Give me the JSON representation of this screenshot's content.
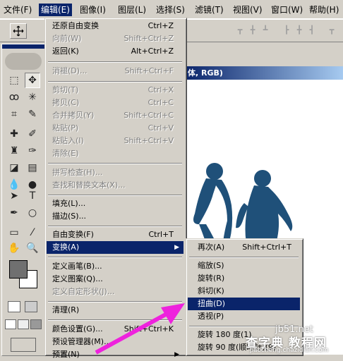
{
  "menubar": {
    "items": [
      "文件(F)",
      "编辑(E)",
      "图像(I)",
      "图层(L)",
      "选择(S)",
      "滤镜(T)",
      "视图(V)",
      "窗口(W)",
      "帮助(H)"
    ]
  },
  "document": {
    "title_visible": "体, RGB)"
  },
  "edit_menu": {
    "items": [
      {
        "label": "还原自由变换",
        "shortcut": "Ctrl+Z"
      },
      {
        "label": "向前(W)",
        "shortcut": "Shift+Ctrl+Z"
      },
      {
        "label": "返回(K)",
        "shortcut": "Alt+Ctrl+Z"
      },
      {
        "label": "消褪(D)...",
        "shortcut": "Shift+Ctrl+F"
      },
      {
        "label": "剪切(T)",
        "shortcut": "Ctrl+X"
      },
      {
        "label": "拷贝(C)",
        "shortcut": "Ctrl+C"
      },
      {
        "label": "合并拷贝(Y)",
        "shortcut": "Shift+Ctrl+C"
      },
      {
        "label": "粘贴(P)",
        "shortcut": "Ctrl+V"
      },
      {
        "label": "粘贴入(I)",
        "shortcut": "Shift+Ctrl+V"
      },
      {
        "label": "清除(E)",
        "shortcut": ""
      },
      {
        "label": "拼写检查(H)...",
        "shortcut": ""
      },
      {
        "label": "查找和替换文本(X)...",
        "shortcut": ""
      },
      {
        "label": "填充(L)...",
        "shortcut": ""
      },
      {
        "label": "描边(S)...",
        "shortcut": ""
      },
      {
        "label": "自由变换(F)",
        "shortcut": "Ctrl+T"
      },
      {
        "label": "变换(A)",
        "shortcut": ""
      },
      {
        "label": "定义画笔(B)...",
        "shortcut": ""
      },
      {
        "label": "定义图案(Q)...",
        "shortcut": ""
      },
      {
        "label": "定义自定形状(J)...",
        "shortcut": ""
      },
      {
        "label": "清理(R)",
        "shortcut": ""
      },
      {
        "label": "颜色设置(G)...",
        "shortcut": "Shift+Ctrl+K"
      },
      {
        "label": "预设管理器(M)...",
        "shortcut": ""
      },
      {
        "label": "预置(N)",
        "shortcut": ""
      }
    ]
  },
  "transform_menu": {
    "items": [
      {
        "label": "再次(A)",
        "shortcut": "Shift+Ctrl+T"
      },
      {
        "label": "缩放(S)",
        "shortcut": ""
      },
      {
        "label": "旋转(R)",
        "shortcut": ""
      },
      {
        "label": "斜切(K)",
        "shortcut": ""
      },
      {
        "label": "扭曲(D)",
        "shortcut": ""
      },
      {
        "label": "透视(P)",
        "shortcut": ""
      },
      {
        "label": "旋转 180 度(1)",
        "shortcut": ""
      },
      {
        "label": "旋转 90 度(顺时针)(9)",
        "shortcut": ""
      }
    ]
  },
  "watermark": {
    "line1": "jb51.net",
    "line2": "查字典 教程网",
    "line3": "jiaocheng.chazidian.com"
  },
  "colors": {
    "menu_bg": "#d4d0c8",
    "highlight": "#0a246a",
    "silhouette": "#1f5079",
    "arrow": "#ee22dd"
  }
}
